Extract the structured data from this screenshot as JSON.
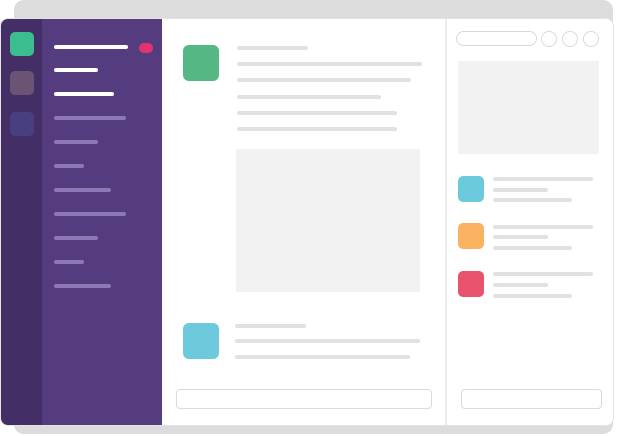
{
  "colors": {
    "teams_rail": "#432f65",
    "sidebar": "#543c7f",
    "team_green": "#3cbd8f",
    "team_gray": "#6b5473",
    "team_indigo": "#473f80",
    "badge": "#e2336f",
    "avatar_green": "#54b784",
    "avatar_blue": "#6dcadd",
    "member_blue": "#6bc9dc",
    "member_orange": "#f9b25f",
    "member_red": "#e8526c"
  },
  "icons": {
    "team_1": "team-icon",
    "team_2": "team-icon",
    "team_3": "team-icon",
    "unread": "unread-badge",
    "search": "search-pill",
    "actions": [
      "circle-button",
      "circle-button",
      "circle-button"
    ]
  }
}
